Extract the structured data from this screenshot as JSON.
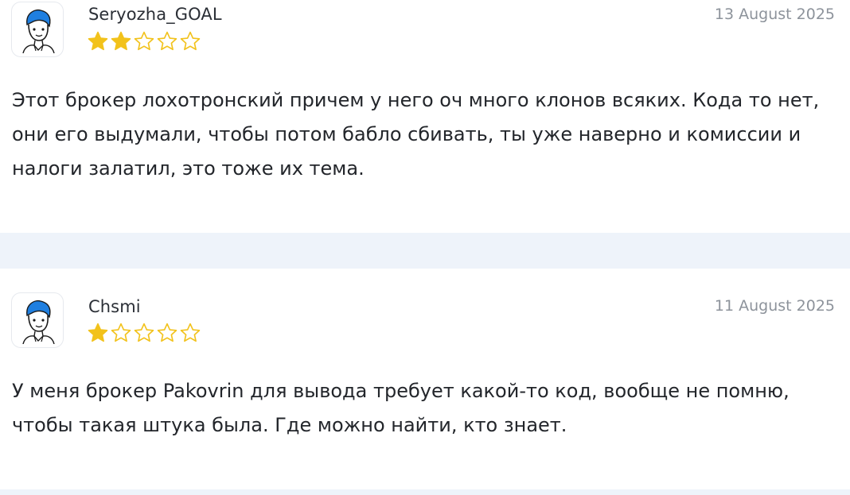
{
  "reviews": [
    {
      "author": "Seryozha_GOAL",
      "date": "13 August 2025",
      "rating": 2,
      "max_rating": 5,
      "avatar_icon": "user-avatar-icon",
      "text": "Этот брокер лохотронский причем у него оч много клонов всяких. Кода то нет, они его выдумали, чтобы потом бабло сбивать, ты уже наверно и комиссии и налоги залатил, это тоже их тема."
    },
    {
      "author": "Chsmi",
      "date": "11 August 2025",
      "rating": 1,
      "max_rating": 5,
      "avatar_icon": "user-avatar-icon",
      "text": "У меня брокер Pakovrin для вывода требует какой-то код, вообще не помню, чтобы такая штука была. Где можно найти, кто знает."
    }
  ],
  "colors": {
    "star_filled": "#f2c21b",
    "star_empty_stroke": "#f2c21b",
    "separator_band": "#eef3fa",
    "avatar_hair": "#1f7fe0"
  }
}
